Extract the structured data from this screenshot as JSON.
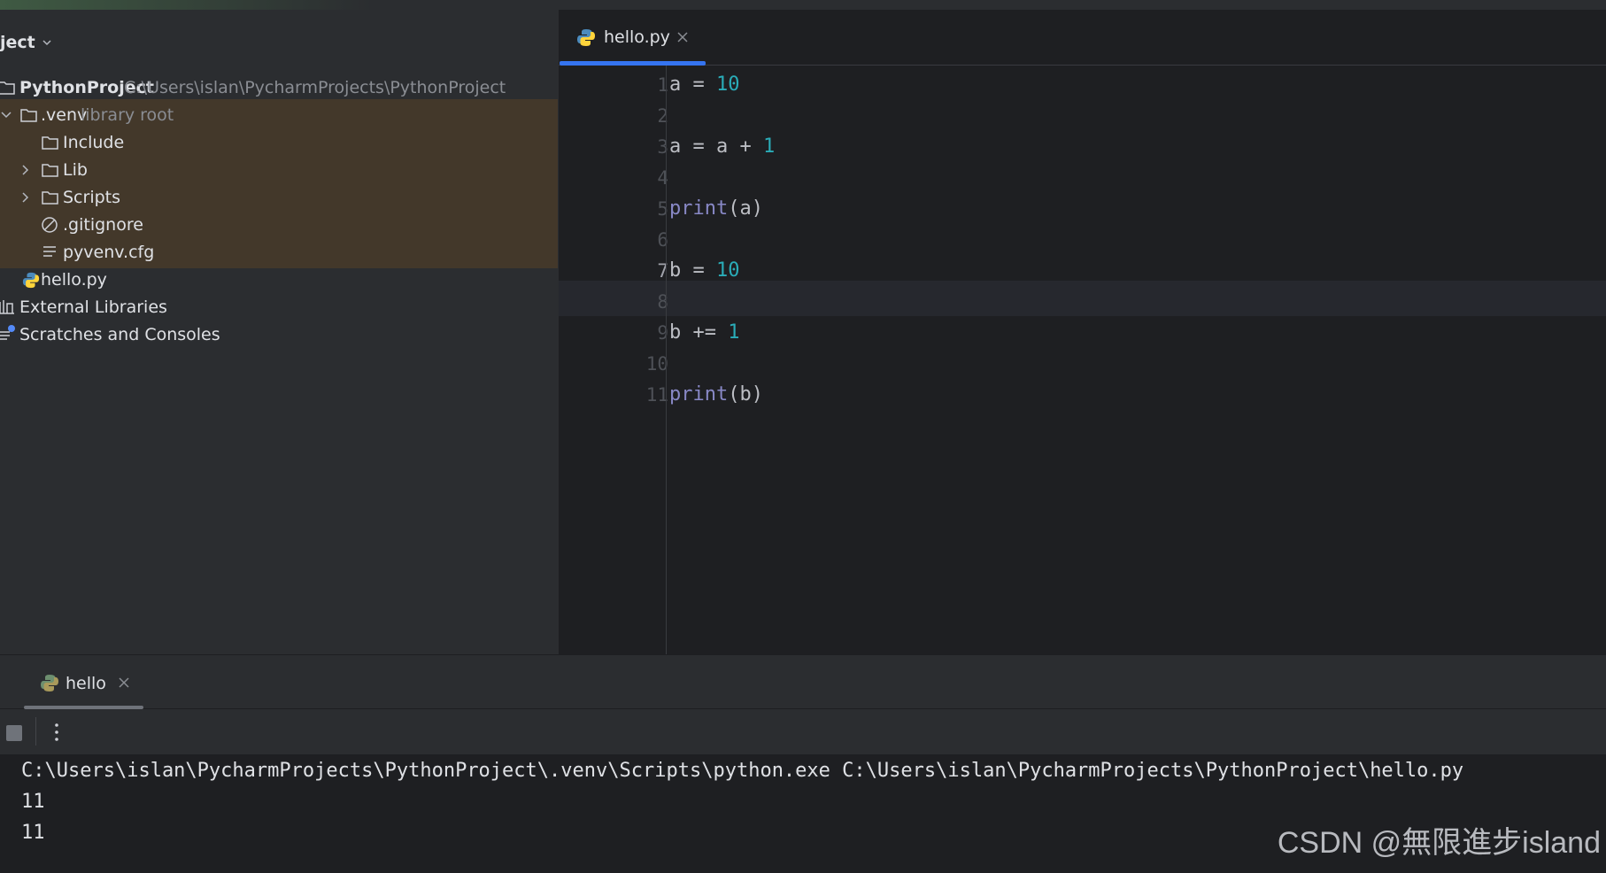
{
  "project_panel": {
    "title": "ject",
    "tree": [
      {
        "name": "PythonProject",
        "hint": "C:\\Users\\islan\\PycharmProjects\\PythonProject"
      },
      {
        "name": ".venv",
        "hint": "library root"
      },
      {
        "name": "Include"
      },
      {
        "name": "Lib"
      },
      {
        "name": "Scripts"
      },
      {
        "name": ".gitignore"
      },
      {
        "name": "pyvenv.cfg"
      },
      {
        "name": "hello.py"
      },
      {
        "name": "External Libraries"
      },
      {
        "name": "Scratches and Consoles"
      }
    ]
  },
  "editor": {
    "tab": {
      "label": "hello.py"
    },
    "line_numbers": [
      "1",
      "2",
      "3",
      "4",
      "5",
      "6",
      "7",
      "8",
      "9",
      "10",
      "11"
    ],
    "current_line": 7,
    "code": {
      "l1": {
        "a": "a = ",
        "b": "10"
      },
      "l3": {
        "a": "a = a + ",
        "b": "1"
      },
      "l5": {
        "fn": "print",
        "rest": "(a)"
      },
      "l7": {
        "a": "b = ",
        "b": "10"
      },
      "l9": {
        "a": "b += ",
        "b": "1"
      },
      "l11": {
        "fn": "print",
        "rest": "(b)"
      }
    }
  },
  "run_panel": {
    "tab_label": "hello",
    "output": [
      "C:\\Users\\islan\\PycharmProjects\\PythonProject\\.venv\\Scripts\\python.exe C:\\Users\\islan\\PycharmProjects\\PythonProject\\hello.py",
      "11",
      "11"
    ]
  },
  "watermark": "CSDN @無限進步island",
  "colors": {
    "accent": "#3574f0",
    "number": "#2aacb8",
    "builtin": "#8888c6",
    "selection": "#43382a"
  }
}
